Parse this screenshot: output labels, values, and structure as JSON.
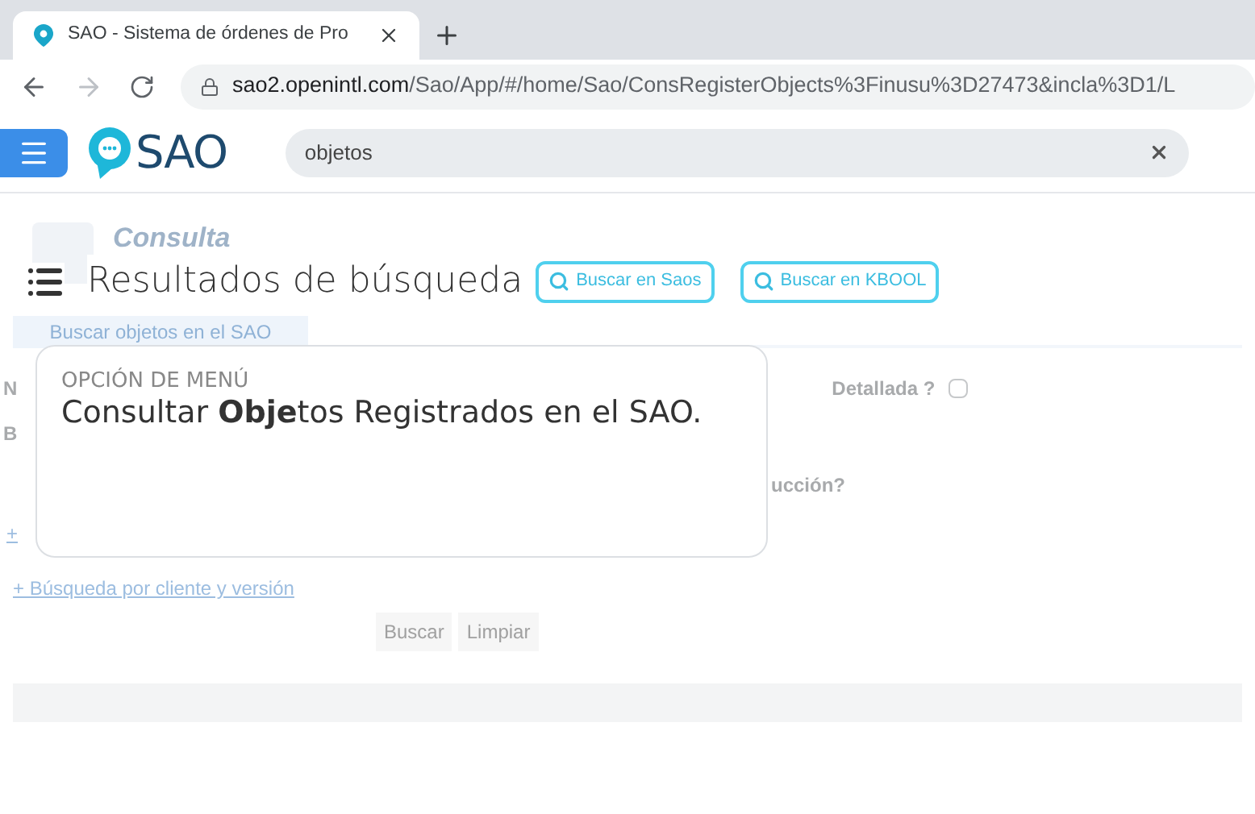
{
  "browser": {
    "tab_title": "SAO - Sistema de órdenes de Pro",
    "url_host": "sao2.openintl.com",
    "url_path": "/Sao/App/#/home/Sao/ConsRegisterObjects%3Finusu%3D27473&incla%3D1/L"
  },
  "header": {
    "logo_text": "SAO",
    "search": {
      "value": "objetos"
    }
  },
  "background_form": {
    "title": "Consulta",
    "tab": "Buscar objetos en el SAO",
    "label_1": "N",
    "detailed_label": "Detallada ?",
    "detailed_checked": false,
    "label_2": "B",
    "question": "ucción?",
    "link_1": "+",
    "link_2": "+ Búsqueda por cliente y versión",
    "buttons": [
      "Buscar",
      "Limpiar"
    ]
  },
  "results": {
    "title": "Resultados de búsqueda",
    "buttons": [
      "Buscar en Saos",
      "Buscar en KBOOL"
    ]
  },
  "card": {
    "category": "OPCIÓN DE MENÚ",
    "text": "Consultar **Obje**tos Registrados en el SAO."
  }
}
